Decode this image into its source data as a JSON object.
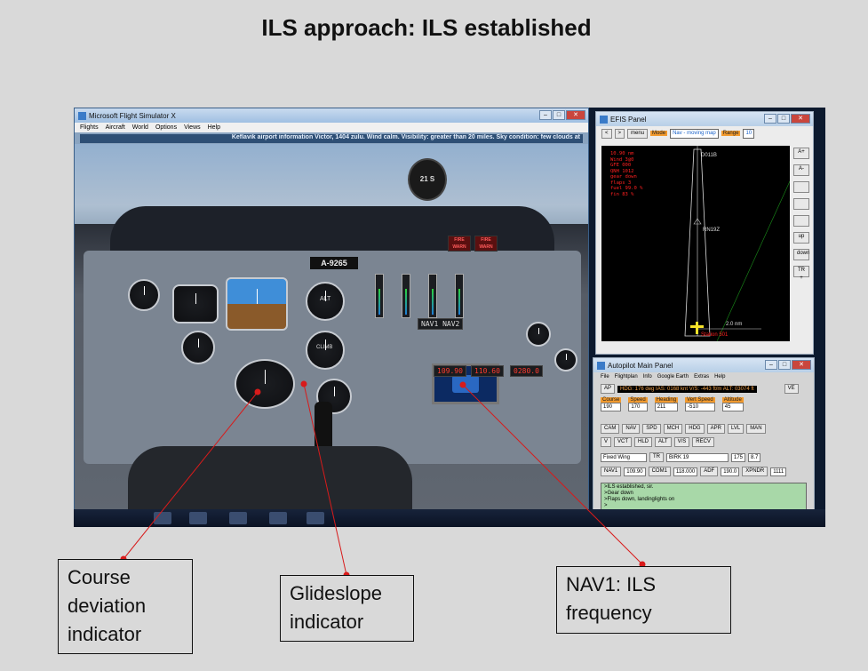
{
  "slide": {
    "title": "ILS approach: ILS established"
  },
  "fsx": {
    "title": "Microsoft Flight Simulator X",
    "menu": [
      "Flights",
      "Aircraft",
      "World",
      "Options",
      "Views",
      "Help"
    ],
    "atis": "Keflavik airport information Victor, 1404 zulu. Wind calm. Visibility: greater than 20 miles. Sky condition: few clouds at",
    "registration": "A-9265",
    "fire_warn_1": "FIRE WARN",
    "fire_warn_2": "FIRE WARN",
    "compass": "21 S",
    "nav1_display": "109.90",
    "nav1_standby": "110.60",
    "radio_3": "0280.0",
    "nav_labels": [
      "NAV1",
      "NAV2"
    ],
    "climb_label": "CLIMB",
    "alt_label": "ALT"
  },
  "efis": {
    "title": "EFIS Panel",
    "buttons": [
      "<",
      ">",
      "menu"
    ],
    "mode_label": "Mode",
    "mode_value": "Nav - moving map",
    "range_label": "Range",
    "range_value": "10",
    "info": "10.90 nm\nWind 3@0\nGFE 000\nQNH 1012\ngear down\nflaps 3\nfuel 99.0 %\nfin 83 %",
    "waypoint_top": "D011B",
    "waypoint_mid": "RN19Z",
    "scale": "2.0 nm",
    "bottom_label": "Station 501",
    "side_buttons": [
      "A+",
      "A-",
      "",
      "",
      "",
      "up",
      "down",
      "TR +"
    ]
  },
  "autopilot": {
    "title": "Autopilot Main Panel",
    "menu": [
      "File",
      "Flightplan",
      "Info",
      "Google Earth",
      "Extras",
      "Help"
    ],
    "ap_button": "AP",
    "ve_button": "VE",
    "status": "HDG: 176 deg IAS: 0168 knt V/S: -443 ft/m ALT: 03074 ft",
    "fields": [
      {
        "label": "Course",
        "value": "190"
      },
      {
        "label": "Speed",
        "value": "170"
      },
      {
        "label": "Heading",
        "value": "211"
      },
      {
        "label": "Vert Speed",
        "value": "-510"
      },
      {
        "label": "Altitude",
        "value": "45"
      }
    ],
    "row1_buttons": [
      "CAM",
      "NAV",
      "SPD",
      "MCH",
      "HDG",
      "APR",
      "LVL",
      "MAN"
    ],
    "row2_buttons": [
      "V",
      "VCT",
      "HLD",
      "ALT",
      "V/S",
      "RECV"
    ],
    "fixed_wing": "Fixed Wing",
    "tr_button": "TR",
    "airport": "BIRK 19",
    "val_175": "175",
    "val_87": "8.7",
    "nav1_label": "NAV1",
    "nav1_value": "109.90",
    "com1_label": "COM1",
    "com1_value": "118.000",
    "adf_label": "ADF",
    "adf_value": "190.0",
    "xpndr_label": "XPNDR",
    "xpndr_value": "1111",
    "log": [
      ">ILS established, sir.",
      ">Gear down",
      ">Flaps down, landinglights on",
      ">"
    ]
  },
  "callouts": {
    "cdi": "Course deviation indicator",
    "glideslope": "Glideslope indicator",
    "nav1": "NAV1: ILS frequency"
  },
  "colors": {
    "leader": "#d81b1b",
    "background": "#d9d9d9"
  }
}
